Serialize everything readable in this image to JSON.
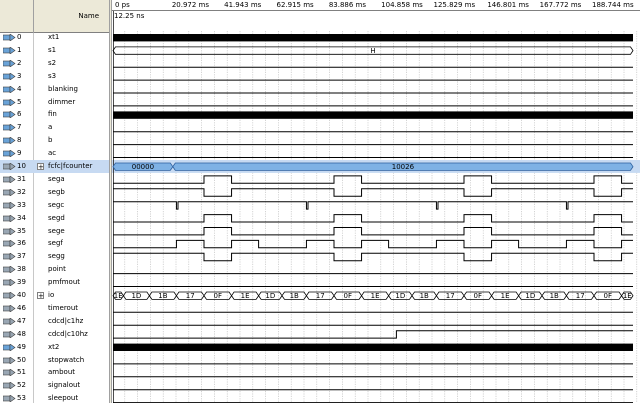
{
  "header": {
    "name_label": "Name"
  },
  "timeline": {
    "labels": [
      "0 ps",
      "20.972 ms",
      "41.943 ms",
      "62.915 ms",
      "83.886 ms",
      "104.858 ms",
      "125.829 ms",
      "146.801 ms",
      "167.772 ms",
      "188.744 ms"
    ],
    "cursor_label": "12.25 ns"
  },
  "signals": [
    {
      "idx": "0",
      "name": "xt1",
      "kind": "input",
      "wave": {
        "type": "high"
      }
    },
    {
      "idx": "1",
      "name": "s1",
      "kind": "input",
      "wave": {
        "type": "bus",
        "segs": [
          {
            "label": "H",
            "start": 0,
            "end": 1
          }
        ]
      }
    },
    {
      "idx": "2",
      "name": "s2",
      "kind": "input",
      "wave": {
        "type": "low"
      }
    },
    {
      "idx": "3",
      "name": "s3",
      "kind": "input",
      "wave": {
        "type": "low"
      }
    },
    {
      "idx": "4",
      "name": "blanking",
      "kind": "input",
      "wave": {
        "type": "low"
      }
    },
    {
      "idx": "5",
      "name": "dimmer",
      "kind": "input",
      "wave": {
        "type": "low"
      }
    },
    {
      "idx": "6",
      "name": "fin",
      "kind": "input",
      "wave": {
        "type": "high"
      }
    },
    {
      "idx": "7",
      "name": "a",
      "kind": "input",
      "wave": {
        "type": "low"
      }
    },
    {
      "idx": "8",
      "name": "b",
      "kind": "input",
      "wave": {
        "type": "low"
      }
    },
    {
      "idx": "9",
      "name": "ac",
      "kind": "input",
      "wave": {
        "type": "low"
      }
    },
    {
      "idx": "10",
      "name": "fcfc|fcounter",
      "kind": "output",
      "expand": "+",
      "selected": true,
      "wave": {
        "type": "bus",
        "segs": [
          {
            "label": "00000",
            "start": 0,
            "end": 0.115
          },
          {
            "label": "10026",
            "start": 0.115,
            "end": 1
          }
        ]
      }
    },
    {
      "idx": "31",
      "name": "sega",
      "kind": "output",
      "wave": {
        "type": "digital",
        "init": 0,
        "toggles": [
          0.175,
          0.228,
          0.425,
          0.478,
          0.675,
          0.728,
          0.925,
          0.978
        ]
      }
    },
    {
      "idx": "32",
      "name": "segb",
      "kind": "output",
      "wave": {
        "type": "digital",
        "init": 1,
        "toggles": [
          0.175,
          0.228,
          0.425,
          0.478,
          0.675,
          0.728,
          0.925,
          0.978
        ]
      }
    },
    {
      "idx": "33",
      "name": "segc",
      "kind": "output",
      "wave": {
        "type": "digital",
        "init": 1,
        "toggles": [
          0.122,
          0.125,
          0.372,
          0.375,
          0.622,
          0.625,
          0.872,
          0.875
        ]
      }
    },
    {
      "idx": "34",
      "name": "segd",
      "kind": "output",
      "wave": {
        "type": "digital",
        "init": 0,
        "toggles": [
          0.175,
          0.228,
          0.425,
          0.478,
          0.675,
          0.728,
          0.925,
          0.978
        ]
      }
    },
    {
      "idx": "35",
      "name": "sege",
      "kind": "output",
      "wave": {
        "type": "digital",
        "init": 0,
        "toggles": [
          0.175,
          0.228,
          0.425,
          0.478,
          0.675,
          0.728,
          0.925,
          0.978
        ]
      }
    },
    {
      "idx": "36",
      "name": "segf",
      "kind": "output",
      "wave": {
        "type": "digital",
        "init": 0,
        "toggles": [
          0.122,
          0.175,
          0.228,
          0.28,
          0.372,
          0.425,
          0.478,
          0.53,
          0.622,
          0.675,
          0.728,
          0.78,
          0.872,
          0.925,
          0.978
        ]
      }
    },
    {
      "idx": "37",
      "name": "segg",
      "kind": "output",
      "wave": {
        "type": "digital",
        "init": 1,
        "toggles": [
          0.175,
          0.228,
          0.425,
          0.478,
          0.675,
          0.728,
          0.925,
          0.978
        ]
      }
    },
    {
      "idx": "38",
      "name": "point",
      "kind": "output",
      "wave": {
        "type": "low"
      }
    },
    {
      "idx": "39",
      "name": "pmfmout",
      "kind": "output",
      "wave": {
        "type": "low"
      }
    },
    {
      "idx": "40",
      "name": "io",
      "kind": "output",
      "expand": "+",
      "wave": {
        "type": "bus",
        "segs": [
          {
            "label": "1E",
            "start": 0,
            "end": 0.02
          },
          {
            "label": "1D",
            "start": 0.02,
            "end": 0.07
          },
          {
            "label": "1B",
            "start": 0.07,
            "end": 0.122
          },
          {
            "label": "17",
            "start": 0.122,
            "end": 0.175
          },
          {
            "label": "0F",
            "start": 0.175,
            "end": 0.228
          },
          {
            "label": "1E",
            "start": 0.228,
            "end": 0.28
          },
          {
            "label": "1D",
            "start": 0.28,
            "end": 0.325
          },
          {
            "label": "1B",
            "start": 0.325,
            "end": 0.372
          },
          {
            "label": "17",
            "start": 0.372,
            "end": 0.425
          },
          {
            "label": "0F",
            "start": 0.425,
            "end": 0.478
          },
          {
            "label": "1E",
            "start": 0.478,
            "end": 0.53
          },
          {
            "label": "1D",
            "start": 0.53,
            "end": 0.575
          },
          {
            "label": "1B",
            "start": 0.575,
            "end": 0.622
          },
          {
            "label": "17",
            "start": 0.622,
            "end": 0.675
          },
          {
            "label": "0F",
            "start": 0.675,
            "end": 0.728
          },
          {
            "label": "1E",
            "start": 0.728,
            "end": 0.78
          },
          {
            "label": "1D",
            "start": 0.78,
            "end": 0.825
          },
          {
            "label": "1B",
            "start": 0.825,
            "end": 0.872
          },
          {
            "label": "17",
            "start": 0.872,
            "end": 0.925
          },
          {
            "label": "0F",
            "start": 0.925,
            "end": 0.978
          },
          {
            "label": "1E",
            "start": 0.978,
            "end": 1
          }
        ]
      }
    },
    {
      "idx": "46",
      "name": "timerout",
      "kind": "output",
      "wave": {
        "type": "low"
      }
    },
    {
      "idx": "47",
      "name": "cdcd|c1hz",
      "kind": "output",
      "wave": {
        "type": "low"
      }
    },
    {
      "idx": "48",
      "name": "cdcd|c10hz",
      "kind": "output",
      "wave": {
        "type": "digital",
        "init": 0,
        "toggles": [
          0.545
        ]
      }
    },
    {
      "idx": "49",
      "name": "xt2",
      "kind": "input",
      "wave": {
        "type": "high"
      }
    },
    {
      "idx": "50",
      "name": "stopwatch",
      "kind": "output",
      "wave": {
        "type": "low"
      }
    },
    {
      "idx": "51",
      "name": "ambout",
      "kind": "output",
      "wave": {
        "type": "low"
      }
    },
    {
      "idx": "52",
      "name": "signalout",
      "kind": "output",
      "wave": {
        "type": "low"
      }
    },
    {
      "idx": "53",
      "name": "sleepout",
      "kind": "output",
      "wave": {
        "type": "low"
      }
    }
  ]
}
